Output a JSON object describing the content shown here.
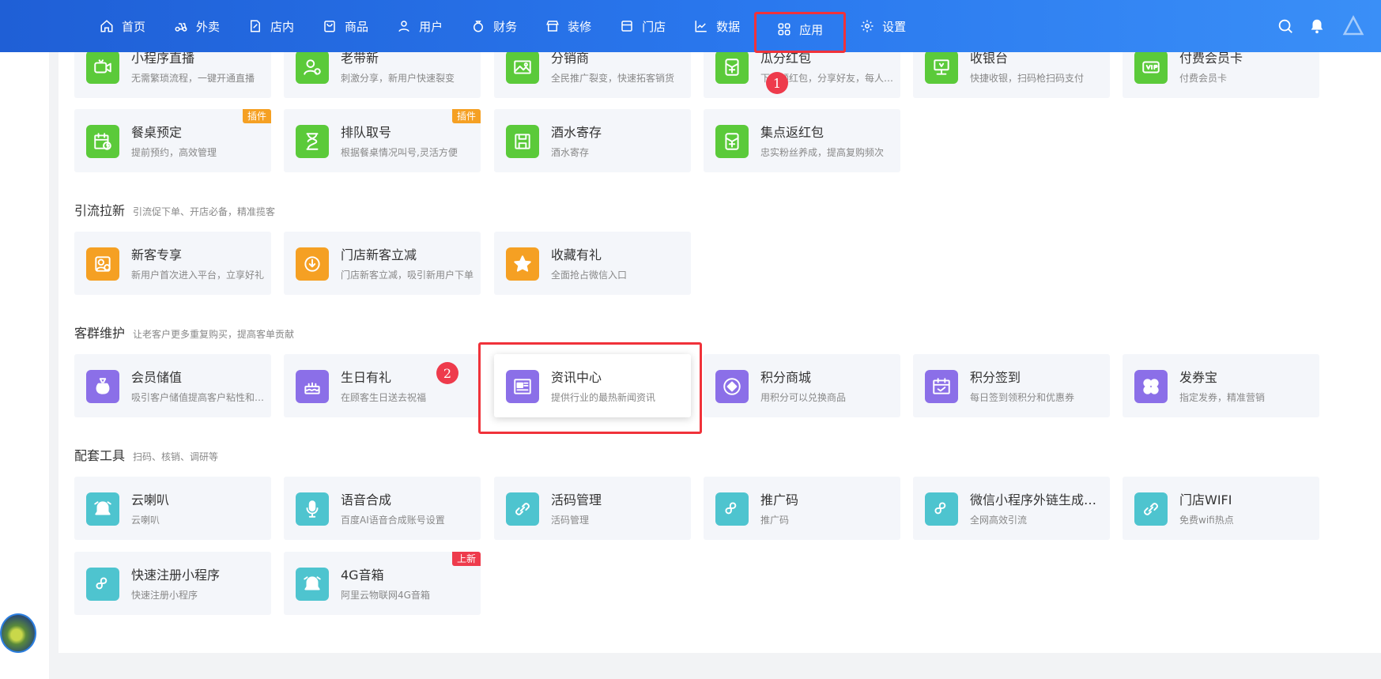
{
  "nav": {
    "items": [
      {
        "label": "首页",
        "icon": "home-icon"
      },
      {
        "label": "外卖",
        "icon": "scooter-icon"
      },
      {
        "label": "店内",
        "icon": "edit-icon"
      },
      {
        "label": "商品",
        "icon": "shopping-bag-icon"
      },
      {
        "label": "用户",
        "icon": "user-icon"
      },
      {
        "label": "财务",
        "icon": "money-bag-icon"
      },
      {
        "label": "装修",
        "icon": "storefront-icon"
      },
      {
        "label": "门店",
        "icon": "store-icon"
      },
      {
        "label": "数据",
        "icon": "line-chart-icon"
      },
      {
        "label": "应用",
        "icon": "apps-grid-icon"
      },
      {
        "label": "设置",
        "icon": "gear-icon"
      }
    ],
    "active": "应用"
  },
  "markers": {
    "one": "1",
    "two": "2"
  },
  "sections": {
    "yinliu": {
      "title": "引流拉新",
      "subtitle": "引流促下单、开店必备，精准揽客"
    },
    "kequn": {
      "title": "客群维护",
      "subtitle": "让老客户更多重复购买，提高客单贡献"
    },
    "peitao": {
      "title": "配套工具",
      "subtitle": "扫码、核销、调研等"
    }
  },
  "tiles": {
    "r1": [
      {
        "name": "小程序直播",
        "desc": "无需繁琐流程，一键开通直播",
        "color": "#5bca3a",
        "icon": "live-video-icon"
      },
      {
        "name": "老带新",
        "desc": "刺激分享，新用户快速裂变",
        "color": "#5bca3a",
        "icon": "user-add-icon"
      },
      {
        "name": "分销商",
        "desc": "全民推广裂变，快速拓客销货",
        "color": "#5bca3a",
        "icon": "image-icon"
      },
      {
        "name": "瓜分红包",
        "desc": "下单领红包，分享好友，每人都能领",
        "color": "#5bca3a",
        "icon": "red-envelope-icon"
      },
      {
        "name": "收银台",
        "desc": "快捷收银，扫码枪扫码支付",
        "color": "#5bca3a",
        "icon": "cashier-icon"
      },
      {
        "name": "付费会员卡",
        "desc": "付费会员卡",
        "color": "#5bca3a",
        "icon": "vip-card-icon"
      }
    ],
    "r2": [
      {
        "name": "餐桌预定",
        "desc": "提前预约，高效管理",
        "color": "#5bca3a",
        "icon": "calendar-clock-icon",
        "badge": "插件"
      },
      {
        "name": "排队取号",
        "desc": "根据餐桌情况叫号,灵活方便",
        "color": "#5bca3a",
        "icon": "hourglass-icon",
        "badge": "插件"
      },
      {
        "name": "酒水寄存",
        "desc": "酒水寄存",
        "color": "#5bca3a",
        "icon": "save-icon"
      },
      {
        "name": "集点返红包",
        "desc": "忠实粉丝养成，提高复购频次",
        "color": "#5bca3a",
        "icon": "red-envelope-icon"
      }
    ],
    "r3": [
      {
        "name": "新客专享",
        "desc": "新用户首次进入平台，立享好礼",
        "color": "#f5a023",
        "icon": "new-user-gift-icon"
      },
      {
        "name": "门店新客立减",
        "desc": "门店新客立减，吸引新用户下单",
        "color": "#f5a023",
        "icon": "discount-icon"
      },
      {
        "name": "收藏有礼",
        "desc": "全面抢占微信入口",
        "color": "#f5a023",
        "icon": "star-icon"
      }
    ],
    "r4": [
      {
        "name": "会员储值",
        "desc": "吸引客户储值提高客户粘性和复购",
        "color": "#8b6fe8",
        "icon": "money-bag-icon"
      },
      {
        "name": "生日有礼",
        "desc": "在顾客生日送去祝福",
        "color": "#8b6fe8",
        "icon": "birthday-cake-icon"
      },
      {
        "name": "资讯中心",
        "desc": "提供行业的最热新闻资讯",
        "color": "#8b6fe8",
        "icon": "news-icon"
      },
      {
        "name": "积分商城",
        "desc": "用积分可以兑换商品",
        "color": "#8b6fe8",
        "icon": "points-coin-icon"
      },
      {
        "name": "积分签到",
        "desc": "每日签到领积分和优惠券",
        "color": "#8b6fe8",
        "icon": "calendar-check-icon"
      },
      {
        "name": "发券宝",
        "desc": "指定发券，精准营销",
        "color": "#8b6fe8",
        "icon": "clover-icon"
      }
    ],
    "r5": [
      {
        "name": "云喇叭",
        "desc": "云喇叭",
        "color": "#4ec4cf",
        "icon": "bell-alarm-icon"
      },
      {
        "name": "语音合成",
        "desc": "百度AI语音合成账号设置",
        "color": "#4ec4cf",
        "icon": "microphone-icon"
      },
      {
        "name": "活码管理",
        "desc": "活码管理",
        "color": "#4ec4cf",
        "icon": "link-icon"
      },
      {
        "name": "推广码",
        "desc": "推广码",
        "color": "#4ec4cf",
        "icon": "mini-program-icon"
      },
      {
        "name": "微信小程序外链生成工具",
        "desc": "全网高效引流",
        "color": "#4ec4cf",
        "icon": "mini-program-icon"
      },
      {
        "name": "门店WIFI",
        "desc": "免费wifi热点",
        "color": "#4ec4cf",
        "icon": "link-icon"
      }
    ],
    "r6": [
      {
        "name": "快速注册小程序",
        "desc": "快速注册小程序",
        "color": "#4ec4cf",
        "icon": "mini-program-icon"
      },
      {
        "name": "4G音箱",
        "desc": "阿里云物联网4G音箱",
        "color": "#4ec4cf",
        "icon": "bell-alarm-icon",
        "badge": "上新"
      }
    ]
  }
}
